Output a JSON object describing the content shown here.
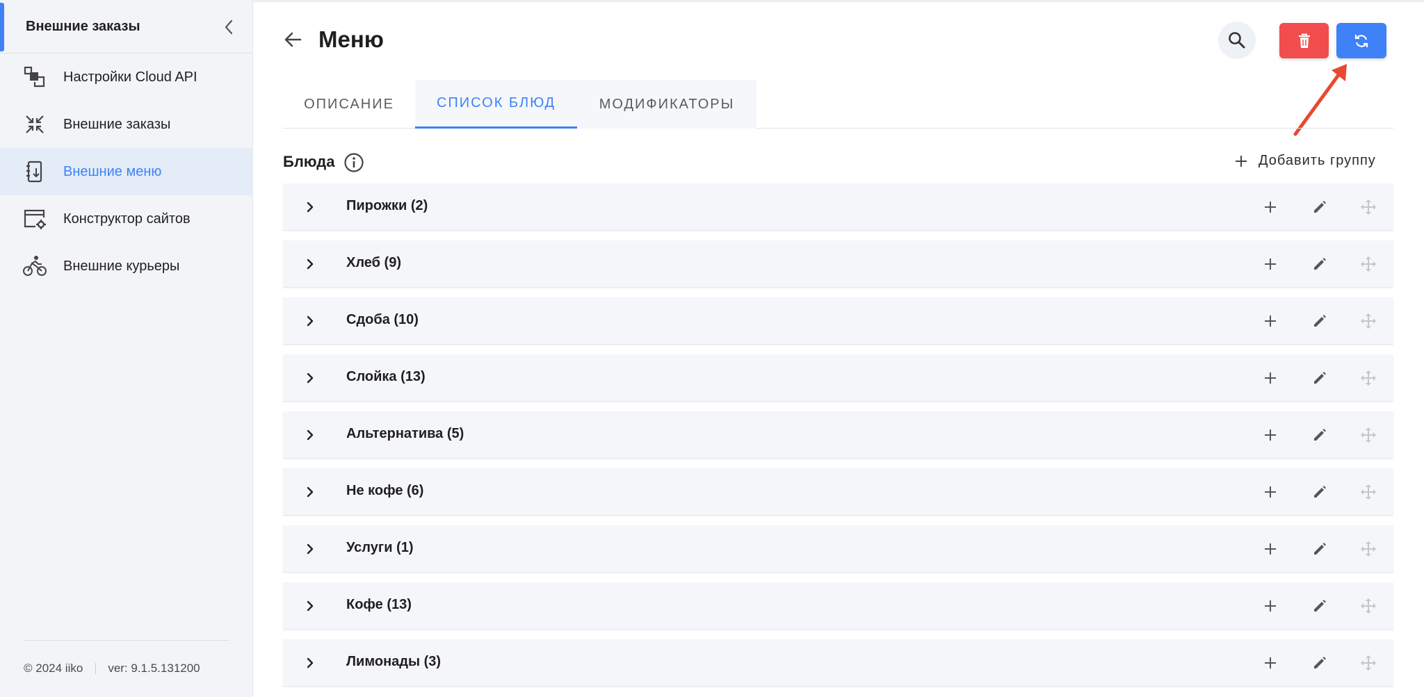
{
  "sidebar": {
    "title": "Внешние заказы",
    "items": [
      {
        "label": "Настройки Cloud API",
        "icon": "cloud-api-settings-icon"
      },
      {
        "label": "Внешние заказы",
        "icon": "external-orders-icon"
      },
      {
        "label": "Внешние меню",
        "icon": "external-menu-icon",
        "active": true
      },
      {
        "label": "Конструктор сайтов",
        "icon": "site-builder-icon"
      },
      {
        "label": "Внешние курьеры",
        "icon": "courier-bike-icon"
      }
    ],
    "footer": {
      "copyright": "© 2024 iiko",
      "version": "ver: 9.1.5.131200"
    }
  },
  "header": {
    "title": "Меню",
    "delete_color": "#f24d4d",
    "sync_color": "#3f82f7"
  },
  "tabs": [
    {
      "label": "ОПИСАНИЕ"
    },
    {
      "label": "СПИСОК БЛЮД",
      "active": true
    },
    {
      "label": "МОДИФИКАТОРЫ"
    }
  ],
  "section": {
    "title": "Блюда",
    "add_group_label": "Добавить группу"
  },
  "groups": [
    {
      "name": "Пирожки (2)"
    },
    {
      "name": "Хлеб (9)"
    },
    {
      "name": "Сдоба (10)"
    },
    {
      "name": "Слойка (13)"
    },
    {
      "name": "Альтернатива (5)"
    },
    {
      "name": "Не кофе (6)"
    },
    {
      "name": "Услуги (1)"
    },
    {
      "name": "Кофе (13)"
    },
    {
      "name": "Лимонады (3)"
    }
  ],
  "colors": {
    "accent": "#3f82f7",
    "danger": "#f24d4d",
    "annotation": "#e8492f"
  }
}
